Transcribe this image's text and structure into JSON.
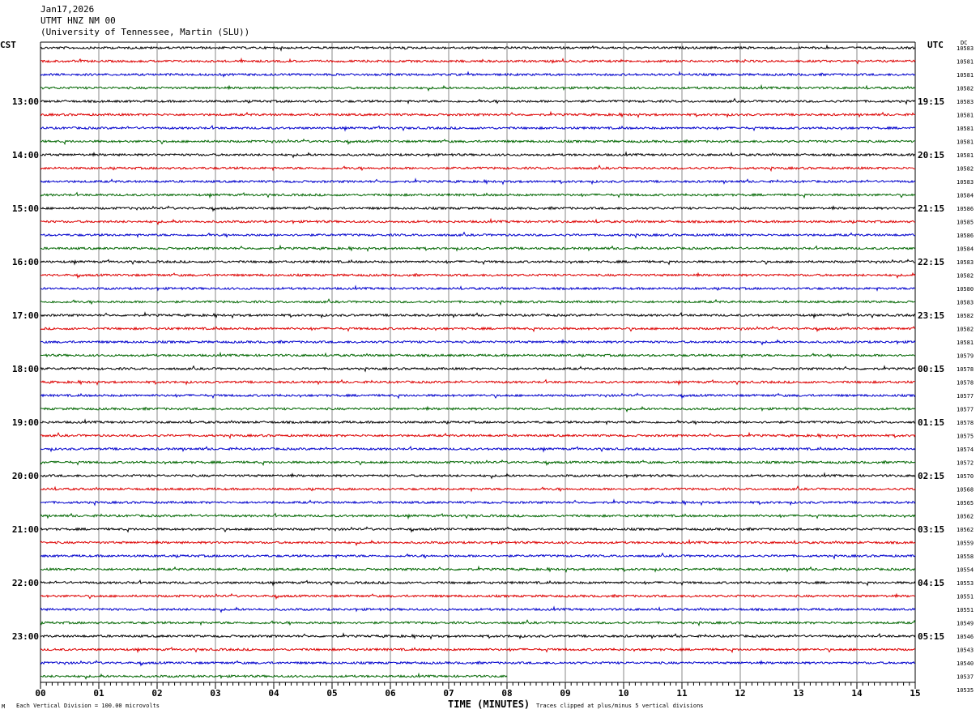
{
  "header": {
    "date": "Jan17,2026",
    "station": "UTMT HNZ NM 00",
    "network": "(University of Tennessee, Martin (SLU))"
  },
  "left_timezone": "CST",
  "right_timezone": "UTC",
  "dc_label": "DC",
  "footer": {
    "scale_note": "Each Vertical Division =  100.00 microvolts",
    "clip_note": "Traces clipped at plus/minus 5 vertical divisions",
    "corner_mark": "M"
  },
  "colors": {
    "trace_cycle": [
      "#000000",
      "#dd0000",
      "#0000cc",
      "#006600"
    ],
    "grid": "#888888"
  },
  "chart_data": {
    "type": "line",
    "title": "",
    "xlabel": "TIME (MINUTES)",
    "x_range": [
      0,
      15
    ],
    "x_ticks": [
      "00",
      "01",
      "02",
      "03",
      "04",
      "05",
      "06",
      "07",
      "08",
      "09",
      "10",
      "11",
      "12",
      "13",
      "14",
      "15"
    ],
    "hour_labels_cst": [
      "13:00",
      "14:00",
      "15:00",
      "16:00",
      "17:00",
      "18:00",
      "19:00",
      "20:00",
      "21:00",
      "22:00",
      "23:00"
    ],
    "hour_labels_utc": [
      "19:15",
      "20:15",
      "21:15",
      "22:15",
      "23:15",
      "00:15",
      "01:15",
      "02:15",
      "03:15",
      "04:15",
      "05:15"
    ],
    "dc_values": [
      "10583",
      "10581",
      "10581",
      "10582",
      "10583",
      "10581",
      "10581",
      "10581",
      "10581",
      "10582",
      "10583",
      "10584",
      "10586",
      "10585",
      "10586",
      "10584",
      "10583",
      "10582",
      "10580",
      "10583",
      "10582",
      "10582",
      "10581",
      "10579",
      "10578",
      "10578",
      "10577",
      "10577",
      "10578",
      "10575",
      "10574",
      "10572",
      "10570",
      "10568",
      "10565",
      "10562",
      "10562",
      "10559",
      "10558",
      "10554",
      "10553",
      "10551",
      "10551",
      "10549",
      "10546",
      "10543",
      "10540",
      "10537",
      "10535"
    ],
    "trace_count": 48,
    "last_trace_end_minute": 8.0
  }
}
